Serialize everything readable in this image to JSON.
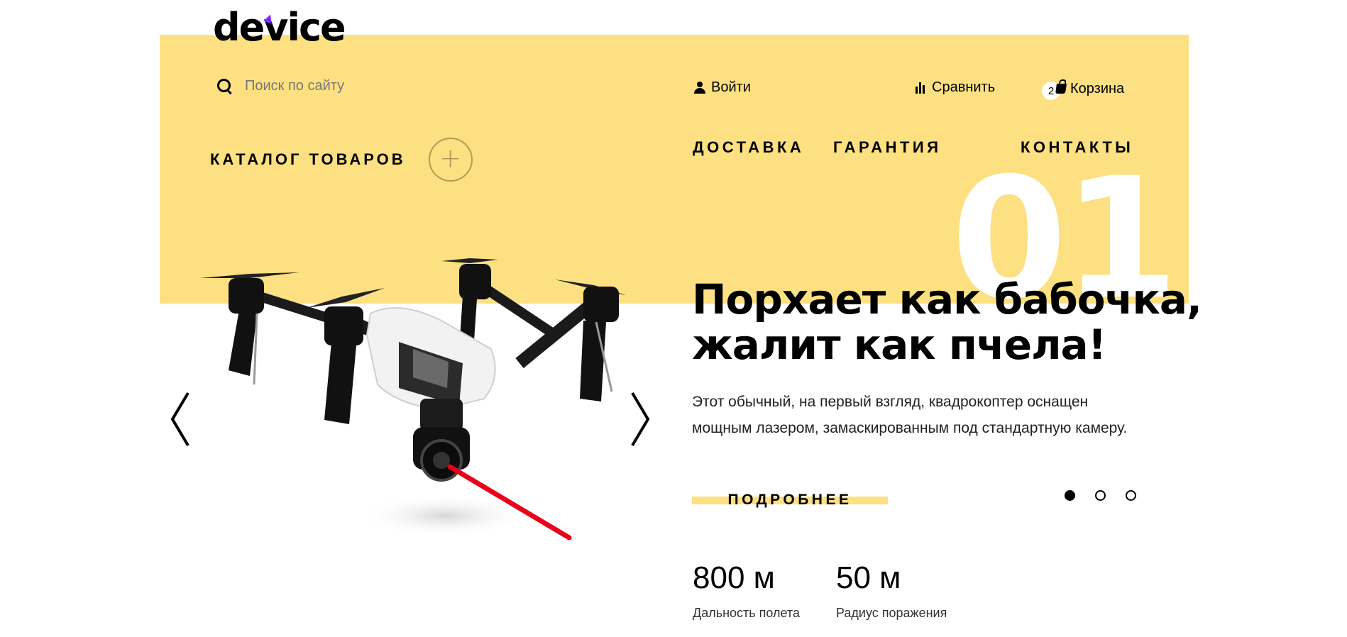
{
  "header": {
    "logo": "device",
    "search_placeholder": "Поиск по сайту",
    "login_label": "Войти",
    "compare_label": "Сравнить",
    "cart_label": "Корзина",
    "cart_count": "2"
  },
  "nav": {
    "catalog_label": "КАТАЛОГ ТОВАРОВ",
    "catalog_toggle": "+",
    "items": [
      "ДОСТАВКА",
      "ГАРАНТИЯ",
      "КОНТАКТЫ"
    ]
  },
  "slider": {
    "slide_number": "01",
    "title_line1": "Порхает как бабочка,",
    "title_line2": "жалит как пчела!",
    "text_line1": "Этот обычный, на первый взгляд, квадрокоптер оснащен",
    "text_line2": "мощным лазером, замаскированным под стандартную камеру.",
    "more_label": "ПОДРОБНЕЕ",
    "slides_total": 3,
    "active_slide": 1
  },
  "stats": [
    {
      "value": "800 м",
      "label": "Дальность полета"
    },
    {
      "value": "50 м",
      "label": "Радиус поражения"
    }
  ],
  "colors": {
    "accent_yellow": "#fde082",
    "logo_accent": "#7a2cff",
    "laser": "#e8001a"
  },
  "icons": {
    "search": "search-icon",
    "user": "user-icon",
    "compare": "bar-chart-icon",
    "cart": "shopping-bag-icon",
    "prev": "chevron-left-icon",
    "next": "chevron-right-icon"
  }
}
